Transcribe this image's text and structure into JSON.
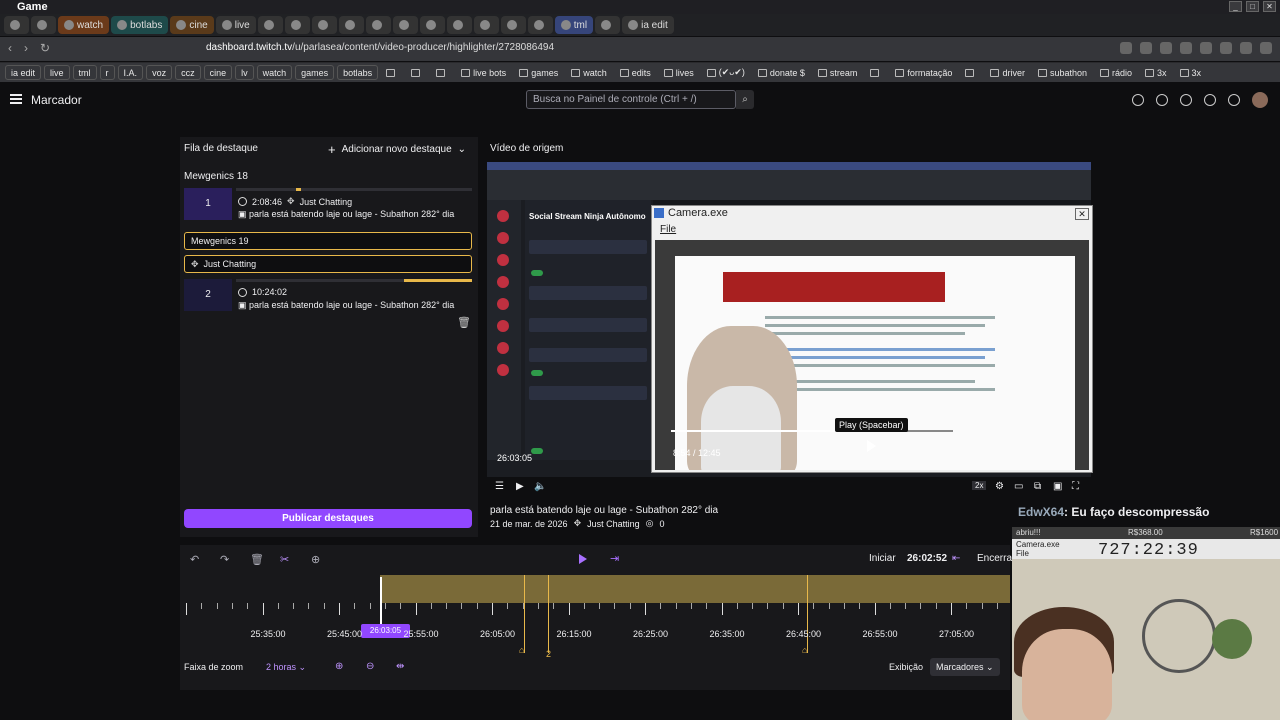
{
  "window": {
    "title": "Game"
  },
  "tabs": [
    {
      "label": "",
      "style": "dark"
    },
    {
      "label": "",
      "style": "dark"
    },
    {
      "label": "watch",
      "style": "orange"
    },
    {
      "label": "botlabs",
      "style": "teal"
    },
    {
      "label": "cine",
      "style": "brown"
    },
    {
      "label": "live",
      "style": "dark"
    },
    {
      "label": "",
      "style": "dark"
    },
    {
      "label": "",
      "style": "dark"
    },
    {
      "label": "",
      "style": "dark"
    },
    {
      "label": "",
      "style": "dark"
    },
    {
      "label": "",
      "style": "dark"
    },
    {
      "label": "",
      "style": "dark"
    },
    {
      "label": "",
      "style": "dark"
    },
    {
      "label": "",
      "style": "dark"
    },
    {
      "label": "",
      "style": "dark"
    },
    {
      "label": "",
      "style": "dark"
    },
    {
      "label": "",
      "style": "dark"
    },
    {
      "label": "tml",
      "style": "blue"
    },
    {
      "label": "",
      "style": "dark"
    },
    {
      "label": "ia edit",
      "style": "dark"
    }
  ],
  "address": {
    "host": "dashboard.twitch.tv",
    "path": "/u/parlasea/content/video-producer/highlighter/2728086494"
  },
  "bookmarks": [
    "ia edit",
    "live",
    "tml",
    "r",
    "I.A.",
    "voz",
    "ccz",
    "cine",
    "lv",
    "watch",
    "games",
    "botlabs",
    "",
    "",
    "",
    "live bots",
    "games",
    "watch",
    "edits",
    "lives",
    "(✔ᴗ✔)",
    "donate $",
    "stream",
    "",
    "formatação",
    "",
    "driver",
    "subathon",
    "rádio",
    "3x",
    "3x"
  ],
  "header": {
    "title": "Marcador",
    "search_placeholder": "Busca no Painel de controle (Ctrl + /)"
  },
  "queue": {
    "title": "Fila de destaque",
    "add_label": "Adicionar novo destaque",
    "group1": "Mewgenics 18",
    "item1": {
      "num": "1",
      "time": "2:08:46",
      "category": "Just Chatting",
      "title": "parla está batendo laje ou lage - Subathon 282° dia",
      "progress": 0.02
    },
    "edit_title": "Mewgenics 19",
    "edit_category": "Just Chatting",
    "item2": {
      "num": "2",
      "time": "10:24:02",
      "title": "parla está batendo laje ou lage - Subathon 282° dia",
      "progress": 0.29
    },
    "publish_label": "Publicar destaques"
  },
  "source": {
    "label": "Vídeo de origem",
    "time": "26:03:05",
    "info_title": "parla está batendo laje ou lage - Subathon 282° dia",
    "info_date": "21 de mar. de 2026",
    "info_category": "Just Chatting",
    "info_views": "0",
    "speed": "2x"
  },
  "overlay": {
    "ssn_title": "Social Stream Ninja Autônomo",
    "camera_title": "Camera.exe",
    "camera_menu": "File",
    "tooltip": "Play (Spacebar)",
    "yt_time": "8:54 / 12:45"
  },
  "timeline": {
    "start_label": "Iniciar",
    "start_time": "26:02:52",
    "end_label": "Encerrar",
    "playhead": "26:03:05",
    "ticks": [
      "25:35:00",
      "25:45:00",
      "25:55:00",
      "26:05:00",
      "26:15:00",
      "26:25:00",
      "26:35:00",
      "26:45:00",
      "26:55:00",
      "27:05:00",
      "27:15:00"
    ],
    "marker_label": "2",
    "zoom_label": "Faixa de zoom",
    "zoom_value": "2 horas",
    "view_label": "Exibição",
    "markers_label": "Marcadores"
  },
  "webcam": {
    "chat_user": "EdwX64",
    "chat_msg": ": Eu faço descompressão",
    "top_left": "abriu!!!",
    "top_mid": "R$368.00",
    "top_right": "R$1600",
    "cam_title": "Camera.exe",
    "cam_menu": "File",
    "clock": "727:22:39"
  },
  "colors": {
    "accent": "#9147ff",
    "highlight": "#e8b84a"
  }
}
